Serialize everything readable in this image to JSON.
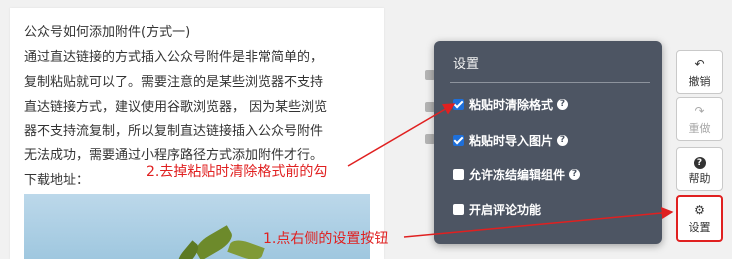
{
  "document": {
    "lines": [
      "公众号如何添加附件(方式一)",
      "通过直达链接的方式插入公众号附件是非常简单的，",
      "复制粘贴就可以了。需要注意的是某些浏览器不支持",
      "直达链接方式，建议使用谷歌浏览器，  因为某些浏览",
      "器不支持流复制，所以复制直达链接插入公众号附件",
      "无法成功，需要通过小程序路径方式添加附件才行。",
      "下载地址："
    ]
  },
  "settings_panel": {
    "title": "设置",
    "options": [
      {
        "label": "粘贴时清除格式",
        "checked": true
      },
      {
        "label": "粘贴时导入图片",
        "checked": true
      },
      {
        "label": "允许冻结编辑组件",
        "checked": false
      },
      {
        "label": "开启评论功能",
        "checked": false
      }
    ]
  },
  "toolbar": {
    "undo_label": "撤销",
    "redo_label": "重做",
    "help_label": "帮助",
    "settings_label": "设置"
  },
  "annotations": {
    "step1": "1.点右侧的设置按钮",
    "step2": "2.去掉粘贴时清除格式前的勾"
  },
  "colors": {
    "annotation_red": "#e02020",
    "panel_bg": "#4d5563",
    "checkbox_blue": "#1e6fd9"
  }
}
